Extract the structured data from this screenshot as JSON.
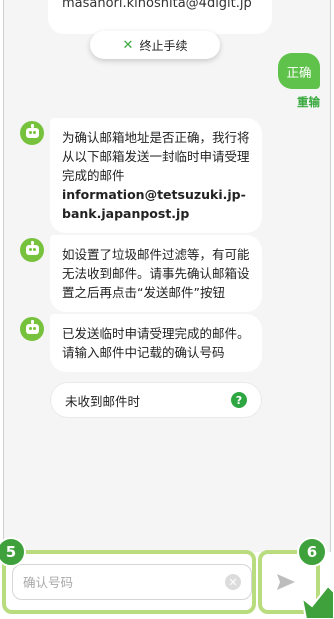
{
  "chat": {
    "top_card_email": "masahori.kinoshita@4digit.jp",
    "cancel_label": "终止手续",
    "user_message": "正确",
    "resend_label": "重输",
    "bot_messages": [
      {
        "line1": "为确认邮箱地址是否正确，我行将从以下邮箱发送一封临时申请受理完成的邮件",
        "email": "information@tetsuzuki.jp-bank.japanpost.jp"
      },
      {
        "text": "如设置了垃圾邮件过滤等，有可能无法收到邮件。请事先确认邮箱设置之后再点击“发送邮件”按钮"
      },
      {
        "text": "已发送临时申请受理完成的邮件。请输入邮件中记载的确认号码"
      }
    ],
    "quick_reply": "未收到邮件时",
    "help_glyph": "?"
  },
  "input": {
    "placeholder": "确认号码",
    "value": ""
  },
  "annotations": {
    "badge_input": "5",
    "badge_send": "6"
  },
  "colors": {
    "accent_green": "#5fc24a",
    "highlight_green": "#b9dc7f",
    "badge_green": "#3ea13b",
    "background": "#f5f5f5"
  },
  "icons": {
    "cancel": "close-icon",
    "bot": "bot-avatar-icon",
    "help": "help-icon",
    "clear": "clear-icon",
    "send": "send-icon",
    "pointer": "hand-pointer-icon"
  }
}
